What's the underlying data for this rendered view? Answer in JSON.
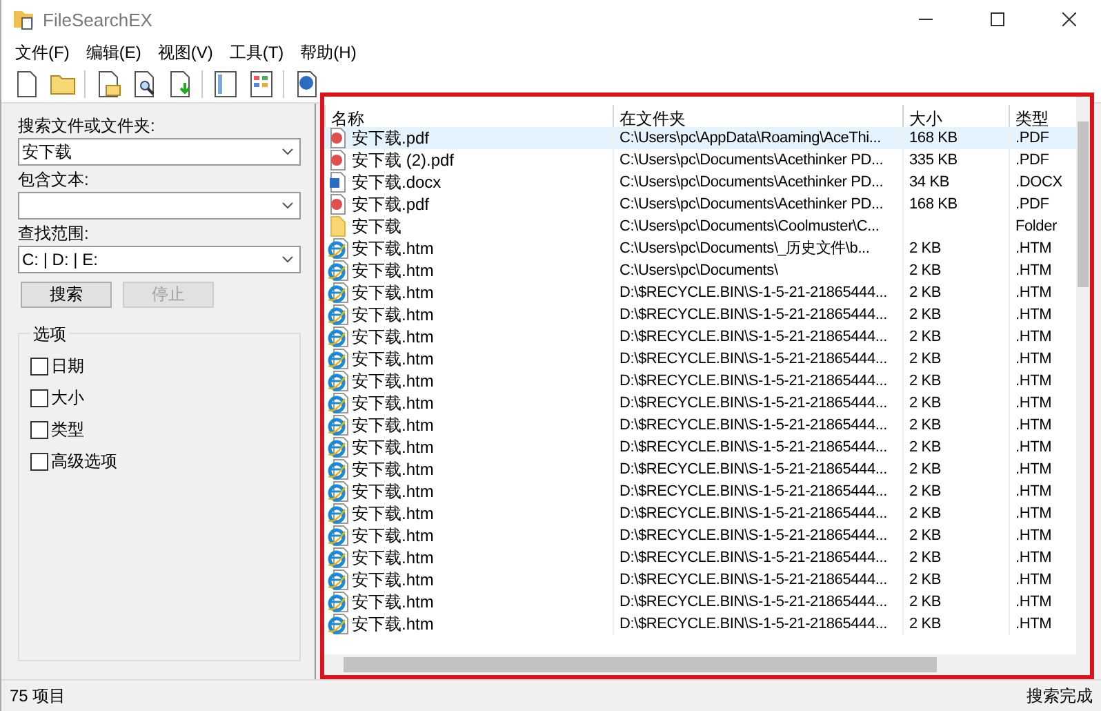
{
  "window": {
    "title": "FileSearchEX"
  },
  "menu": [
    "文件(F)",
    "编辑(E)",
    "视图(V)",
    "工具(T)",
    "帮助(H)"
  ],
  "toolbar": [
    {
      "kind": "new-file"
    },
    {
      "kind": "folder"
    },
    {
      "kind": "sep"
    },
    {
      "kind": "file-folder"
    },
    {
      "kind": "file-search"
    },
    {
      "kind": "file-download"
    },
    {
      "kind": "sep"
    },
    {
      "kind": "panel"
    },
    {
      "kind": "grid"
    },
    {
      "kind": "sep"
    },
    {
      "kind": "help"
    }
  ],
  "search_panel": {
    "fields": [
      {
        "label": "搜索文件或文件夹:",
        "value": "安下载"
      },
      {
        "label": "包含文本:"
      },
      {
        "label": "查找范围:",
        "value": "C: | D: | E:"
      }
    ],
    "buttons": [
      {
        "label": "搜索",
        "disabled": false
      },
      {
        "label": "停止",
        "disabled": true
      }
    ],
    "options": {
      "title": "选项",
      "items": [
        {
          "label": "日期",
          "checked": false
        },
        {
          "label": "大小",
          "checked": false
        },
        {
          "label": "类型",
          "checked": false
        },
        {
          "label": "高级选项",
          "checked": false
        }
      ]
    }
  },
  "table": {
    "columns": [
      "名称",
      "在文件夹",
      "大小",
      "类型"
    ],
    "rows": [
      {
        "kind": "pdf",
        "selected": true,
        "cells": [
          "安下载.pdf",
          "C:\\Users\\pc\\AppData\\Roaming\\AceThi...",
          "168 KB",
          ".PDF"
        ]
      },
      {
        "kind": "pdf",
        "selected": false,
        "cells": [
          "安下载 (2).pdf",
          "C:\\Users\\pc\\Documents\\Acethinker PD...",
          "335 KB",
          ".PDF"
        ]
      },
      {
        "kind": "word",
        "selected": false,
        "cells": [
          "安下载.docx",
          "C:\\Users\\pc\\Documents\\Acethinker PD...",
          "34 KB",
          ".DOCX"
        ]
      },
      {
        "kind": "pdf",
        "selected": false,
        "cells": [
          "安下载.pdf",
          "C:\\Users\\pc\\Documents\\Acethinker PD...",
          "168 KB",
          ".PDF"
        ]
      },
      {
        "kind": "folder",
        "selected": false,
        "cells": [
          "安下载",
          "C:\\Users\\pc\\Documents\\Coolmuster\\C...",
          "",
          "Folder"
        ]
      },
      {
        "kind": "htm",
        "selected": false,
        "cells": [
          "安下载.htm",
          "C:\\Users\\pc\\Documents\\_历史文件\\b...",
          "2 KB",
          ".HTM"
        ]
      },
      {
        "kind": "htm",
        "selected": false,
        "cells": [
          "安下载.htm",
          "C:\\Users\\pc\\Documents\\",
          "2 KB",
          ".HTM"
        ]
      },
      {
        "kind": "htm",
        "selected": false,
        "cells": [
          "安下载.htm",
          "D:\\$RECYCLE.BIN\\S-1-5-21-21865444...",
          "2 KB",
          ".HTM"
        ]
      },
      {
        "kind": "htm",
        "selected": false,
        "cells": [
          "安下载.htm",
          "D:\\$RECYCLE.BIN\\S-1-5-21-21865444...",
          "2 KB",
          ".HTM"
        ]
      },
      {
        "kind": "htm",
        "selected": false,
        "cells": [
          "安下载.htm",
          "D:\\$RECYCLE.BIN\\S-1-5-21-21865444...",
          "2 KB",
          ".HTM"
        ]
      },
      {
        "kind": "htm",
        "selected": false,
        "cells": [
          "安下载.htm",
          "D:\\$RECYCLE.BIN\\S-1-5-21-21865444...",
          "2 KB",
          ".HTM"
        ]
      },
      {
        "kind": "htm",
        "selected": false,
        "cells": [
          "安下载.htm",
          "D:\\$RECYCLE.BIN\\S-1-5-21-21865444...",
          "2 KB",
          ".HTM"
        ]
      },
      {
        "kind": "htm",
        "selected": false,
        "cells": [
          "安下载.htm",
          "D:\\$RECYCLE.BIN\\S-1-5-21-21865444...",
          "2 KB",
          ".HTM"
        ]
      },
      {
        "kind": "htm",
        "selected": false,
        "cells": [
          "安下载.htm",
          "D:\\$RECYCLE.BIN\\S-1-5-21-21865444...",
          "2 KB",
          ".HTM"
        ]
      },
      {
        "kind": "htm",
        "selected": false,
        "cells": [
          "安下载.htm",
          "D:\\$RECYCLE.BIN\\S-1-5-21-21865444...",
          "2 KB",
          ".HTM"
        ]
      },
      {
        "kind": "htm",
        "selected": false,
        "cells": [
          "安下载.htm",
          "D:\\$RECYCLE.BIN\\S-1-5-21-21865444...",
          "2 KB",
          ".HTM"
        ]
      },
      {
        "kind": "htm",
        "selected": false,
        "cells": [
          "安下载.htm",
          "D:\\$RECYCLE.BIN\\S-1-5-21-21865444...",
          "2 KB",
          ".HTM"
        ]
      },
      {
        "kind": "htm",
        "selected": false,
        "cells": [
          "安下载.htm",
          "D:\\$RECYCLE.BIN\\S-1-5-21-21865444...",
          "2 KB",
          ".HTM"
        ]
      },
      {
        "kind": "htm",
        "selected": false,
        "cells": [
          "安下载.htm",
          "D:\\$RECYCLE.BIN\\S-1-5-21-21865444...",
          "2 KB",
          ".HTM"
        ]
      },
      {
        "kind": "htm",
        "selected": false,
        "cells": [
          "安下载.htm",
          "D:\\$RECYCLE.BIN\\S-1-5-21-21865444...",
          "2 KB",
          ".HTM"
        ]
      },
      {
        "kind": "htm",
        "selected": false,
        "cells": [
          "安下载.htm",
          "D:\\$RECYCLE.BIN\\S-1-5-21-21865444...",
          "2 KB",
          ".HTM"
        ]
      },
      {
        "kind": "htm",
        "selected": false,
        "cells": [
          "安下载.htm",
          "D:\\$RECYCLE.BIN\\S-1-5-21-21865444...",
          "2 KB",
          ".HTM"
        ]
      },
      {
        "kind": "htm",
        "selected": false,
        "cells": [
          "安下载.htm",
          "D:\\$RECYCLE.BIN\\S-1-5-21-21865444...",
          "2 KB",
          ".HTM"
        ]
      }
    ]
  },
  "status_bar": {
    "count": "75 项目",
    "message": "搜索完成"
  }
}
